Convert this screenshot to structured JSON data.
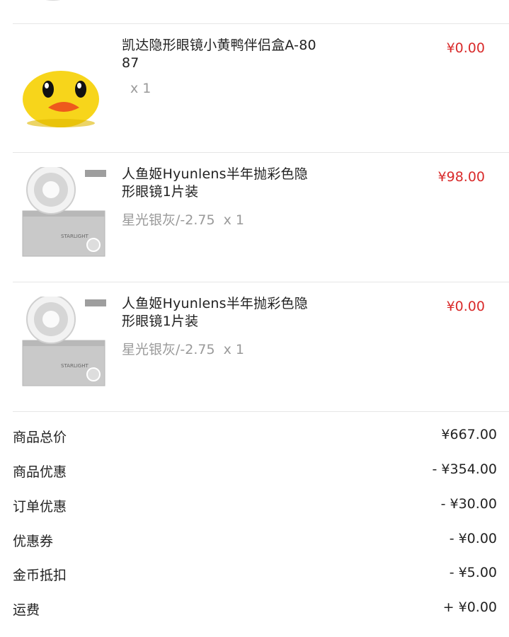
{
  "items": [
    {
      "name": "凯达隐形眼镜小黄鸭伴侣盒A-80\n87",
      "spec": "",
      "qty": "x 1",
      "price": "¥0.00",
      "image_icon": "duck-case-icon"
    },
    {
      "name": "人鱼姬Hyunlens半年抛彩色隐\n形眼镜1片装",
      "spec": "星光银灰/-2.75",
      "qty": "x 1",
      "price": "¥98.00",
      "image_icon": "contact-lens-box-icon"
    },
    {
      "name": "人鱼姬Hyunlens半年抛彩色隐\n形眼镜1片装",
      "spec": "星光银灰/-2.75",
      "qty": "x 1",
      "price": "¥0.00",
      "image_icon": "contact-lens-box-icon"
    }
  ],
  "summary": [
    {
      "label": "商品总价",
      "value": "¥667.00"
    },
    {
      "label": "商品优惠",
      "value": "- ¥354.00"
    },
    {
      "label": "订单优惠",
      "value": "- ¥30.00"
    },
    {
      "label": "优惠券",
      "value": "- ¥0.00"
    },
    {
      "label": "金币抵扣",
      "value": "- ¥5.00"
    },
    {
      "label": "运费",
      "value": "+ ¥0.00"
    }
  ],
  "colors": {
    "price_red": "#d92b2b",
    "divider": "#e6e6e6",
    "muted_text": "#9a9a9a"
  }
}
